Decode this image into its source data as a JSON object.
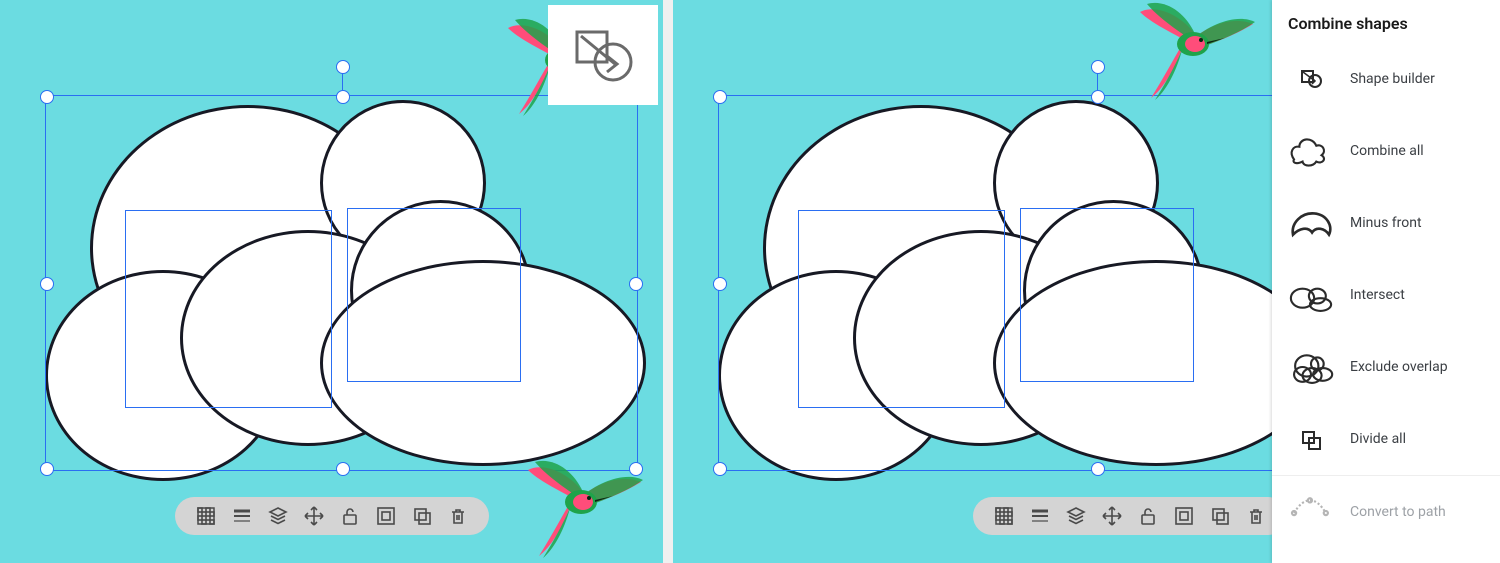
{
  "toolbar": {
    "items": [
      {
        "name": "transparency",
        "icon": "checker"
      },
      {
        "name": "stroke-weight",
        "icon": "lines"
      },
      {
        "name": "arrange",
        "icon": "stack"
      },
      {
        "name": "move",
        "icon": "move"
      },
      {
        "name": "lock",
        "icon": "unlock"
      },
      {
        "name": "group",
        "icon": "group"
      },
      {
        "name": "duplicate",
        "icon": "dup"
      },
      {
        "name": "delete",
        "icon": "trash"
      }
    ]
  },
  "hint": {
    "name": "shape-builder-hint"
  },
  "panel": {
    "title": "Combine shapes",
    "items": [
      {
        "name": "shape-builder",
        "label": "Shape builder",
        "icon": "shapebuilder"
      },
      {
        "name": "combine-all",
        "label": "Combine all",
        "icon": "combine"
      },
      {
        "name": "minus-front",
        "label": "Minus front",
        "icon": "minus"
      },
      {
        "name": "intersect",
        "label": "Intersect",
        "icon": "intersect"
      },
      {
        "name": "exclude-overlap",
        "label": "Exclude overlap",
        "icon": "exclude"
      },
      {
        "name": "divide-all",
        "label": "Divide all",
        "icon": "divide"
      },
      {
        "name": "convert-to-path",
        "label": "Convert to path",
        "icon": "convert",
        "muted": true
      }
    ]
  },
  "colors": {
    "canvas": "#6bdce1",
    "selection": "#2a6ef2",
    "stroke": "#171924"
  }
}
